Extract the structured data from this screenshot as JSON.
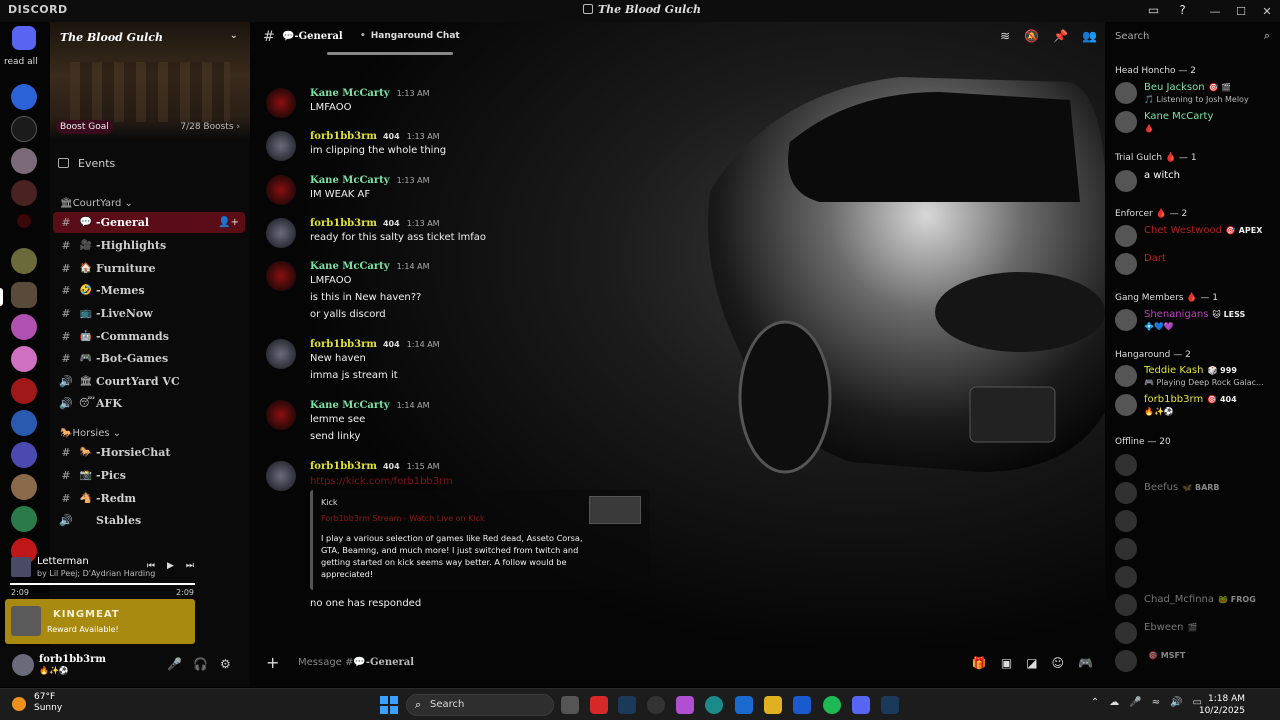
{
  "window": {
    "app_name": "DISCORD",
    "server_title": "The Blood Gulch"
  },
  "rail": {
    "read_all": "read all"
  },
  "server": {
    "name": "The Blood Gulch",
    "boost_goal": "Boost Goal",
    "boost_count": "7/28 Boosts",
    "events": "Events",
    "categories": [
      {
        "label": "CourtYard",
        "emoji": "🏛"
      },
      {
        "label": "Horsies",
        "emoji": "🐎"
      }
    ],
    "channels": [
      {
        "name": "-General",
        "emoji": "💬",
        "type": "#",
        "active": true
      },
      {
        "name": "-Highlights",
        "emoji": "🎥",
        "type": "#"
      },
      {
        "name": "Furniture",
        "emoji": "🏠",
        "type": "#"
      },
      {
        "name": "-Memes",
        "emoji": "🤣",
        "type": "#"
      },
      {
        "name": "-LiveNow",
        "emoji": "📺",
        "type": "#"
      },
      {
        "name": "-Commands",
        "emoji": "🤖",
        "type": "#"
      },
      {
        "name": "-Bot-Games",
        "emoji": "🎮",
        "type": "#"
      },
      {
        "name": "CourtYard VC",
        "emoji": "🏛",
        "type": "🔊"
      },
      {
        "name": "AFK",
        "emoji": "😴",
        "type": "🔊"
      },
      {
        "name": "-HorsieChat",
        "emoji": "🐎",
        "type": "#"
      },
      {
        "name": "-Pics",
        "emoji": "📸",
        "type": "#"
      },
      {
        "name": "-Redm",
        "emoji": "🐴",
        "type": "#"
      },
      {
        "name": "Stables",
        "emoji": "",
        "type": "🔊"
      }
    ]
  },
  "player": {
    "song": "Letterman",
    "artist": "by Lil Peej; D'Aydrian Harding",
    "time_elapsed": "2:09",
    "time_total": "2:09",
    "progress": 1.0
  },
  "reward": {
    "name": "KINGMEAT",
    "label": "Reward Available!"
  },
  "user": {
    "name": "forb1bb3rm",
    "status_emojis": "🔥✨⚽"
  },
  "chat": {
    "channel_emoji": "💬",
    "channel_name": "-General",
    "separator": "•",
    "topic": "Hangaround Chat",
    "messages": [
      {
        "author": "Kane McCarty",
        "type": "kane",
        "tag": "",
        "time": "1:13 AM",
        "lines": [
          "LMFAOO"
        ]
      },
      {
        "author": "forb1bb3rm",
        "type": "forb",
        "tag": "404",
        "time": "1:13 AM",
        "lines": [
          "im clipping the whole thing"
        ]
      },
      {
        "author": "Kane McCarty",
        "type": "kane",
        "tag": "",
        "time": "1:13 AM",
        "lines": [
          "IM WEAK AF"
        ]
      },
      {
        "author": "forb1bb3rm",
        "type": "forb",
        "tag": "404",
        "time": "1:13 AM",
        "lines": [
          "ready for this salty ass ticket lmfao"
        ]
      },
      {
        "author": "Kane McCarty",
        "type": "kane",
        "tag": "",
        "time": "1:14 AM",
        "lines": [
          "LMFAOO",
          "is this in New haven??",
          "or yalls discord"
        ]
      },
      {
        "author": "forb1bb3rm",
        "type": "forb",
        "tag": "404",
        "time": "1:14 AM",
        "lines": [
          "New haven",
          "imma js stream it"
        ]
      },
      {
        "author": "Kane McCarty",
        "type": "kane",
        "tag": "",
        "time": "1:14 AM",
        "lines": [
          "lemme see",
          "send linky"
        ]
      },
      {
        "author": "forb1bb3rm",
        "type": "forb",
        "tag": "404",
        "time": "1:15 AM",
        "lines": []
      }
    ],
    "link": "https://kick.com/forb1bb3rm",
    "embed": {
      "provider": "Kick",
      "title": "Forb1bb3rm Stream - Watch Live on Kick",
      "description": "I play a various selection of games like Red dead, Asseto Corsa, GTA, Beamng, and much more! I just switched from twitch and getting started on kick seems way better. A follow would be appreciated!"
    },
    "after_embed": "no one has responded",
    "composer_placeholder": "Message #"
  },
  "members": {
    "search_placeholder": "Search",
    "groups": [
      {
        "role": "Head Honcho — 2",
        "members": [
          {
            "name": "Beu Jackson",
            "badge": "🎯 🎬",
            "sub": "🎵 Listening to Josh Meloy",
            "color": "#7ee2a6"
          },
          {
            "name": "Kane McCarty",
            "badge": "",
            "sub": "🩸",
            "color": "#7ee2a6"
          }
        ]
      },
      {
        "role": "Trial Gulch 🩸 — 1",
        "members": [
          {
            "name": "a witch",
            "badge": "",
            "sub": "",
            "color": "#ffffff"
          }
        ]
      },
      {
        "role": "Enforcer 🩸 — 2",
        "members": [
          {
            "name": "Chet Westwood",
            "badge": "🎯 APEX",
            "sub": "",
            "color": "#b02020"
          },
          {
            "name": "Dart",
            "badge": "",
            "sub": "",
            "color": "#b02020"
          }
        ]
      },
      {
        "role": "Gang Members 🩸 — 1",
        "members": [
          {
            "name": "Shenanigans",
            "badge": "🐱 LESS",
            "sub": "💠💙💜",
            "color": "#c040c0"
          }
        ]
      },
      {
        "role": "Hangaround — 2",
        "members": [
          {
            "name": "Teddie Kash",
            "badge": "🎲 999",
            "sub": "🎮 Playing Deep Rock Galac...",
            "color": "#e2e23a"
          },
          {
            "name": "forb1bb3rm",
            "badge": "🎯 404",
            "sub": "🔥✨⚽",
            "color": "#e2e23a"
          }
        ]
      },
      {
        "role": "Offline — 20",
        "members": [
          {
            "name": "",
            "badge": "",
            "sub": "",
            "color": "#7a1418"
          },
          {
            "name": "Beefus",
            "badge": "🦋 BARB",
            "sub": "",
            "color": "#cfcfcf"
          },
          {
            "name": "",
            "badge": "",
            "sub": "",
            "color": "#7a1418"
          },
          {
            "name": "",
            "badge": "",
            "sub": "",
            "color": "#7a1418"
          },
          {
            "name": "",
            "badge": "",
            "sub": "",
            "color": "#7a1418"
          },
          {
            "name": "Chad_Mcfinna",
            "badge": "🐸 FROG",
            "sub": "",
            "color": "#cfcfcf"
          },
          {
            "name": "Ebween",
            "badge": "🎬",
            "sub": "",
            "color": "#cfcfcf"
          },
          {
            "name": "",
            "badge": "🎯 MSFT",
            "sub": "",
            "color": "#7a1418"
          }
        ]
      }
    ]
  },
  "taskbar": {
    "temp": "67°F",
    "condition": "Sunny",
    "search_label": "Search",
    "time": "1:18 AM",
    "date": "10/2/2025"
  },
  "colors": {
    "active_channel": "#5a0d16",
    "kane_name": "#7ee2a6",
    "forb_name": "#e2e23a",
    "reward_bg": "#a98a10"
  }
}
